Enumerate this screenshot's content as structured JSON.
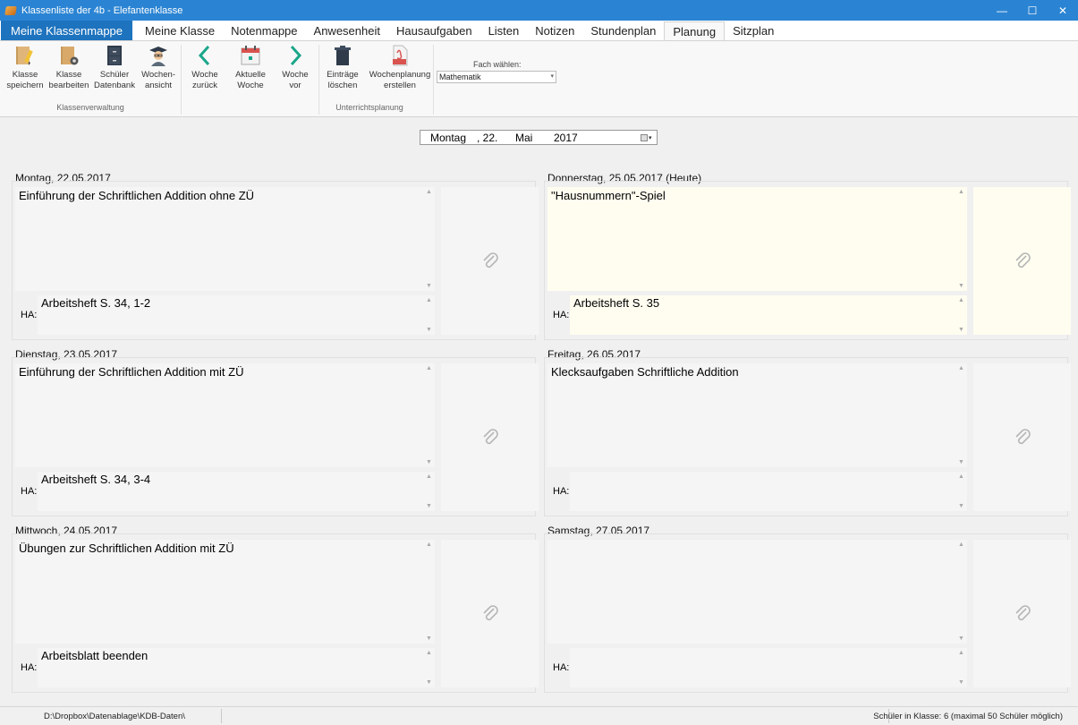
{
  "window": {
    "title": "Klassenliste der 4b - Elefantenklasse",
    "minimize": "—",
    "maximize": "☐",
    "close": "✕"
  },
  "tabs": [
    {
      "label": "Meine Klassenmappe",
      "key": "file"
    },
    {
      "label": "Meine Klasse"
    },
    {
      "label": "Notenmappe"
    },
    {
      "label": "Anwesenheit"
    },
    {
      "label": "Hausaufgaben"
    },
    {
      "label": "Listen"
    },
    {
      "label": "Notizen"
    },
    {
      "label": "Stundenplan"
    },
    {
      "label": "Planung",
      "active": true
    },
    {
      "label": "Sitzplan"
    }
  ],
  "ribbon": {
    "klassenverwaltung": {
      "label": "Klassenverwaltung",
      "buttons": [
        {
          "line1": "Klasse",
          "line2": "speichern",
          "icon": "book-pencil-icon"
        },
        {
          "line1": "Klasse",
          "line2": "bearbeiten",
          "icon": "book-gear-icon"
        },
        {
          "line1": "Schüler",
          "line2": "Datenbank",
          "icon": "file-cabinet-icon"
        },
        {
          "line1": "Wochen-",
          "line2": "ansicht",
          "icon": "teacher-icon"
        }
      ]
    },
    "unterrichtsplanung": {
      "label": "Unterrichtsplanung",
      "buttons": [
        {
          "line1": "Woche",
          "line2": "zurück",
          "icon": "chevron-left-icon"
        },
        {
          "line1": "Aktuelle",
          "line2": "Woche",
          "icon": "calendar-icon"
        },
        {
          "line1": "Woche",
          "line2": "vor",
          "icon": "chevron-right-icon"
        },
        {
          "line1": "Einträge",
          "line2": "löschen",
          "icon": "trash-icon"
        },
        {
          "line1": "Wochenplanung",
          "line2": "erstellen",
          "icon": "pdf-icon"
        }
      ]
    },
    "fach": {
      "label": "Fach wählen:",
      "selected": "Mathematik"
    }
  },
  "date": {
    "weekday": "Montag",
    "day": ", 22.",
    "month": "Mai",
    "year": "2017"
  },
  "days": [
    {
      "heading": "Montag, 22.05.2017",
      "lesson": "Einführung der Schriftlichen Addition ohne ZÜ",
      "ha_label": "HA:",
      "homework": "Arbeitsheft S. 34, 1-2"
    },
    {
      "heading": "Dienstag, 23.05.2017",
      "lesson": "Einführung der Schriftlichen Addition mit ZÜ",
      "ha_label": "HA:",
      "homework": "Arbeitsheft S. 34, 3-4"
    },
    {
      "heading": "Mittwoch, 24.05.2017",
      "lesson": "Übungen zur Schriftlichen Addition mit ZÜ",
      "ha_label": "HA:",
      "homework": "Arbeitsblatt beenden"
    },
    {
      "heading": "Donnerstag, 25.05.2017 (Heute)",
      "lesson": "\"Hausnummern\"-Spiel",
      "ha_label": "HA:",
      "homework": "Arbeitsheft S. 35"
    },
    {
      "heading": "Freitag, 26.05.2017",
      "lesson": "Klecksaufgaben Schriftliche Addition",
      "ha_label": "HA:",
      "homework": ""
    },
    {
      "heading": "Samstag, 27.05.2017",
      "lesson": "",
      "ha_label": "HA:",
      "homework": ""
    }
  ],
  "status": {
    "path": "D:\\Dropbox\\Datenablage\\KDB-Daten\\",
    "count": "Schüler in Klasse: 6 (maximal 50 Schüler möglich)"
  },
  "colors": {
    "titlebar": "#2b84d3",
    "file_tab": "#1e73be",
    "today_bg": "#fffdf0",
    "accent_green": "#1aa68a"
  }
}
